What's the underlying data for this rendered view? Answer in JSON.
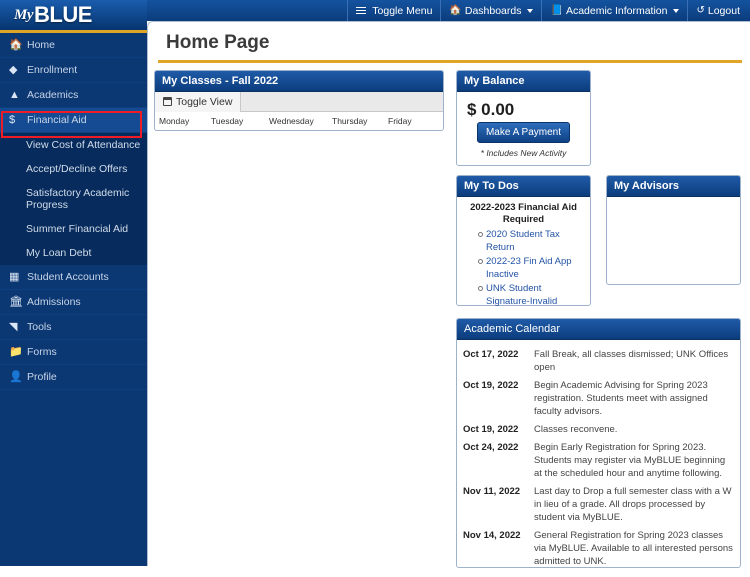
{
  "brand": {
    "my": "My",
    "blue": "BLUE",
    "accent": "#e0a526",
    "primary": "#0b3772"
  },
  "topnav": [
    {
      "label": "Toggle Menu",
      "icon": "hamburger-icon",
      "caret": false
    },
    {
      "label": "Dashboards",
      "icon": "home-icon",
      "caret": true
    },
    {
      "label": "Academic Information",
      "icon": "book-icon",
      "caret": true
    },
    {
      "label": "Logout",
      "icon": "power-icon",
      "caret": false
    }
  ],
  "sidebar": {
    "items": [
      {
        "label": "Home",
        "icon": "home-icon",
        "sub": false,
        "active": false
      },
      {
        "label": "Enrollment",
        "icon": "layers-icon",
        "sub": false,
        "active": false
      },
      {
        "label": "Academics",
        "icon": "graduation-cap-icon",
        "sub": false,
        "active": false
      },
      {
        "label": "Financial Aid",
        "icon": "dollar-icon",
        "sub": false,
        "active": true,
        "highlighted": true
      },
      {
        "label": "View Cost of Attendance",
        "icon": "",
        "sub": true,
        "active": false
      },
      {
        "label": "Accept/Decline Offers",
        "icon": "",
        "sub": true,
        "active": false
      },
      {
        "label": "Satisfactory Academic Progress",
        "icon": "",
        "sub": true,
        "active": false,
        "two_line": true
      },
      {
        "label": "Summer Financial Aid",
        "icon": "",
        "sub": true,
        "active": false
      },
      {
        "label": "My Loan Debt",
        "icon": "",
        "sub": true,
        "active": false
      },
      {
        "label": "Student Accounts",
        "icon": "building-icon",
        "sub": false,
        "active": false
      },
      {
        "label": "Admissions",
        "icon": "bank-icon",
        "sub": false,
        "active": false
      },
      {
        "label": "Tools",
        "icon": "chart-icon",
        "sub": false,
        "active": false
      },
      {
        "label": "Forms",
        "icon": "folder-icon",
        "sub": false,
        "active": false
      },
      {
        "label": "Profile",
        "icon": "user-icon",
        "sub": false,
        "active": false
      }
    ],
    "highlight_color": "#ee1c25"
  },
  "page": {
    "title": "Home Page"
  },
  "classes": {
    "title": "My Classes - Fall 2022",
    "toggle_label": "Toggle View",
    "days": [
      "Monday",
      "Tuesday",
      "Wednesday",
      "Thursday",
      "Friday"
    ]
  },
  "balance": {
    "title": "My Balance",
    "amount": "$ 0.00",
    "button_label": "Make A Payment",
    "note": "* Includes New Activity"
  },
  "todos": {
    "title": "My To Dos",
    "heading": "2022-2023 Financial Aid Required",
    "items": [
      "2020 Student Tax Return",
      "2022-23 Fin Aid App Inactive",
      "UNK Student Signature-Invalid"
    ]
  },
  "advisors": {
    "title": "My Advisors",
    "items": []
  },
  "calendar": {
    "title": "Academic Calendar",
    "rows": [
      {
        "date": "Oct 17, 2022",
        "desc": "Fall Break, all classes dismissed; UNK Offices open"
      },
      {
        "date": "Oct 19, 2022",
        "desc": "Begin Academic Advising for Spring 2023 registration. Students meet with assigned faculty advisors."
      },
      {
        "date": "Oct 19, 2022",
        "desc": "Classes reconvene."
      },
      {
        "date": "Oct 24, 2022",
        "desc": "Begin Early Registration for Spring 2023. Students may register via MyBLUE beginning at the scheduled hour and anytime following."
      },
      {
        "date": "Nov 11, 2022",
        "desc": "Last day to Drop a full semester class with a W in lieu of a grade. All drops processed by student via MyBLUE."
      },
      {
        "date": "Nov 14, 2022",
        "desc": "General Registration for Spring 2023 classes via MyBLUE. Available to all interested persons admitted to UNK."
      }
    ]
  }
}
